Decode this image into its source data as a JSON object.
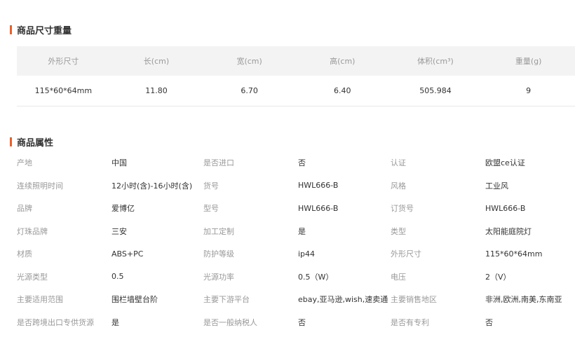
{
  "colors": {
    "accent": "#e8612c",
    "header_bg": "#f3f3f3",
    "label": "#999999",
    "text": "#333333",
    "divider": "#e8e8e8"
  },
  "size_section": {
    "title": "商品尺寸重量",
    "headers": [
      "外形尺寸",
      "长(cm)",
      "宽(cm)",
      "高(cm)",
      "体积(cm³)",
      "重量(g)"
    ],
    "row": [
      "115*60*64mm",
      "11.80",
      "6.70",
      "6.40",
      "505.984",
      "9"
    ]
  },
  "attr_section": {
    "title": "商品属性",
    "rows": [
      [
        {
          "label": "产地",
          "value": "中国"
        },
        {
          "label": "是否进口",
          "value": "否"
        },
        {
          "label": "认证",
          "value": "欧盟ce认证"
        }
      ],
      [
        {
          "label": "连续照明时间",
          "value": "12小时(含)-16小时(含)"
        },
        {
          "label": "货号",
          "value": "HWL666-B"
        },
        {
          "label": "风格",
          "value": "工业风"
        }
      ],
      [
        {
          "label": "品牌",
          "value": "爱博亿"
        },
        {
          "label": "型号",
          "value": "HWL666-B"
        },
        {
          "label": "订货号",
          "value": "HWL666-B"
        }
      ],
      [
        {
          "label": "灯珠品牌",
          "value": "三安"
        },
        {
          "label": "加工定制",
          "value": "是"
        },
        {
          "label": "类型",
          "value": "太阳能庭院灯"
        }
      ],
      [
        {
          "label": "材质",
          "value": "ABS+PC"
        },
        {
          "label": "防护等级",
          "value": "ip44"
        },
        {
          "label": "外形尺寸",
          "value": "115*60*64mm"
        }
      ],
      [
        {
          "label": "光源类型",
          "value": "0.5"
        },
        {
          "label": "光源功率",
          "value": "0.5（W）"
        },
        {
          "label": "电压",
          "value": "2（V）"
        }
      ],
      [
        {
          "label": "主要适用范围",
          "value": "围栏墙壁台阶"
        },
        {
          "label": "主要下游平台",
          "value": "ebay,亚马逊,wish,速卖通"
        },
        {
          "label": "主要销售地区",
          "value": "非洲,欧洲,南美,东南亚"
        }
      ],
      [
        {
          "label": "是否跨境出口专供货源",
          "value": "是"
        },
        {
          "label": "是否一般纳税人",
          "value": "否"
        },
        {
          "label": "是否有专利",
          "value": "否"
        }
      ]
    ]
  }
}
